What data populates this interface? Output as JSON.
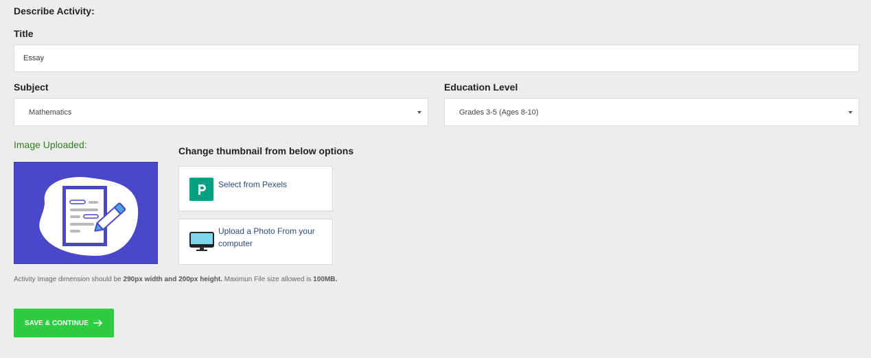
{
  "form": {
    "section_title": "Describe Activity:",
    "title_label": "Title",
    "title_value": "Essay",
    "subject_label": "Subject",
    "subject_value": "Mathematics",
    "education_label": "Education Level",
    "education_value": "Grades 3-5 (Ages 8-10)"
  },
  "image": {
    "uploaded_label": "Image Uploaded:",
    "change_label": "Change thumbnail from below options",
    "pexels_label": "Select from Pexels",
    "upload_label": "Upload a Photo From your computer",
    "help_prefix": "Activity Image dimension should be ",
    "help_dims": "290px width and 200px height.",
    "help_mid": " Maximun File size allowed is ",
    "help_size": "100MB."
  },
  "actions": {
    "save_label": "SAVE & CONTINUE"
  },
  "colors": {
    "accent_green": "#2ecc40",
    "uploaded_label": "#2e7d1f",
    "thumbnail_bg": "#4a47c9",
    "pexels_brand": "#05a081"
  },
  "icons": {
    "pexels": "pexels-logo-icon",
    "upload": "computer-monitor-icon",
    "arrow": "arrow-right-icon",
    "caret": "caret-down-icon"
  }
}
